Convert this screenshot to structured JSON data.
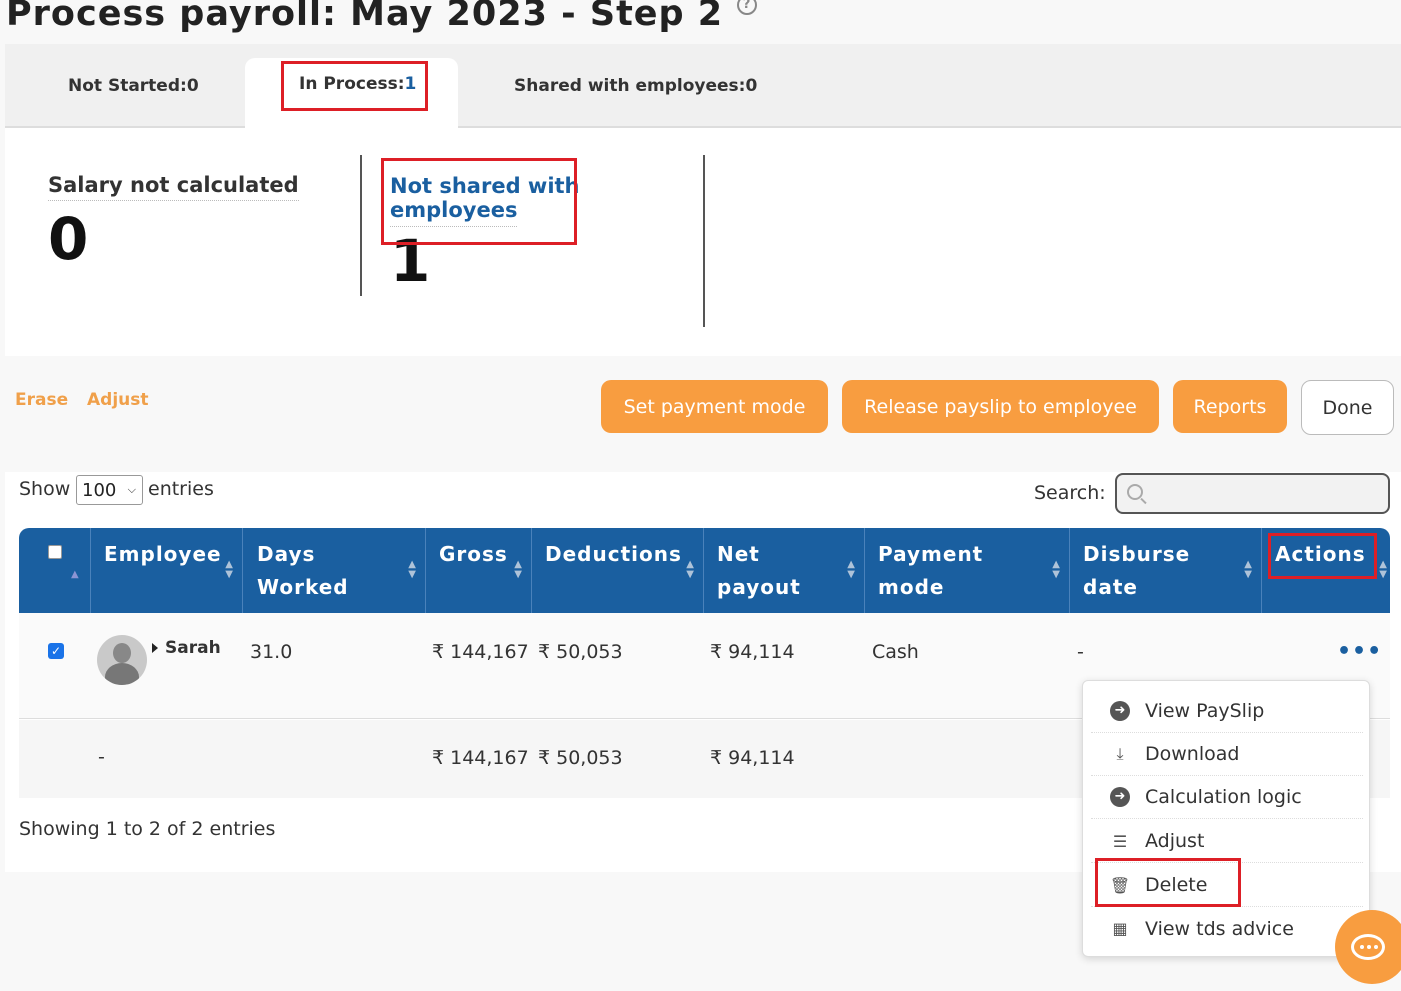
{
  "page": {
    "title": "Process payroll: May 2023 - Step 2"
  },
  "tabs": [
    {
      "label": "Not Started: ",
      "count": "0"
    },
    {
      "label": "In Process: ",
      "count": "1"
    },
    {
      "label": "Shared with employees: ",
      "count": "0"
    }
  ],
  "summary": {
    "salary_not_calculated": {
      "label": "Salary not calculated",
      "value": "0"
    },
    "not_shared": {
      "label_line1": "Not shared with",
      "label_line2": "employees",
      "value": "1"
    }
  },
  "actions": {
    "erase": "Erase",
    "adjust": "Adjust",
    "set_payment_mode": "Set payment mode",
    "release_payslip": "Release payslip to employee",
    "reports": "Reports",
    "done": "Done"
  },
  "table_controls": {
    "show_label": "Show",
    "entries_value": "100",
    "entries_label": "entries",
    "search_label": "Search:"
  },
  "columns": [
    {
      "line1": "Employee",
      "line2": ""
    },
    {
      "line1": "Days",
      "line2": "Worked"
    },
    {
      "line1": "Gross",
      "line2": ""
    },
    {
      "line1": "Deductions",
      "line2": ""
    },
    {
      "line1": "Net",
      "line2": "payout"
    },
    {
      "line1": "Payment",
      "line2": "mode"
    },
    {
      "line1": "Disburse",
      "line2": "date"
    },
    {
      "line1": "Actions",
      "line2": ""
    }
  ],
  "rows": [
    {
      "employee": "Sarah",
      "days_worked": "31.0",
      "gross": "₹ 144,167",
      "deductions": "₹ 50,053",
      "net_payout": "₹ 94,114",
      "payment_mode": "Cash",
      "disburse_date": "-",
      "actions": "•••",
      "checked": true
    },
    {
      "employee": "-",
      "days_worked": "",
      "gross": "₹ 144,167",
      "deductions": "₹ 50,053",
      "net_payout": "₹ 94,114",
      "payment_mode": "",
      "disburse_date": "",
      "actions": ""
    }
  ],
  "footer": {
    "showing": "Showing 1 to 2 of 2 entries"
  },
  "action_menu": [
    {
      "label": "View PaySlip",
      "icon": "arrow-circle-right-icon"
    },
    {
      "label": "Download",
      "icon": "download-icon"
    },
    {
      "label": "Calculation logic",
      "icon": "arrow-circle-right-icon"
    },
    {
      "label": "Adjust",
      "icon": "sliders-icon"
    },
    {
      "label": "Delete",
      "icon": "trash-icon"
    },
    {
      "label": "View tds advice",
      "icon": "calculator-icon"
    }
  ],
  "colors": {
    "primary_blue": "#1a5fa0",
    "orange": "#f89d40",
    "highlight_red": "#dd1f26"
  }
}
